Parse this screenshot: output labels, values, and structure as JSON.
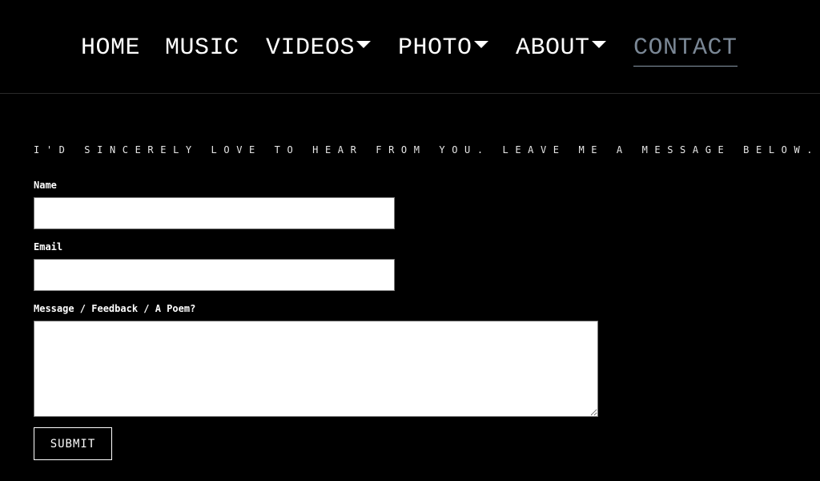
{
  "nav": {
    "items": [
      {
        "label": "HOME",
        "has_dropdown": false,
        "active": false
      },
      {
        "label": "MUSIC",
        "has_dropdown": false,
        "active": false
      },
      {
        "label": "VIDEOS",
        "has_dropdown": true,
        "active": false
      },
      {
        "label": "PHOTO",
        "has_dropdown": true,
        "active": false
      },
      {
        "label": "ABOUT",
        "has_dropdown": true,
        "active": false
      },
      {
        "label": "CONTACT",
        "has_dropdown": false,
        "active": true
      }
    ],
    "active_color": "#7a8795"
  },
  "contact": {
    "tagline": "I'D SINCERELY LOVE TO HEAR FROM YOU. LEAVE ME A MESSAGE BELOW.",
    "fields": {
      "name": {
        "label": "Name",
        "value": "",
        "placeholder": ""
      },
      "email": {
        "label": "Email",
        "value": "",
        "placeholder": ""
      },
      "message": {
        "label": "Message / Feedback / A Poem?",
        "value": "",
        "placeholder": ""
      }
    },
    "submit_label": "SUBMIT"
  }
}
